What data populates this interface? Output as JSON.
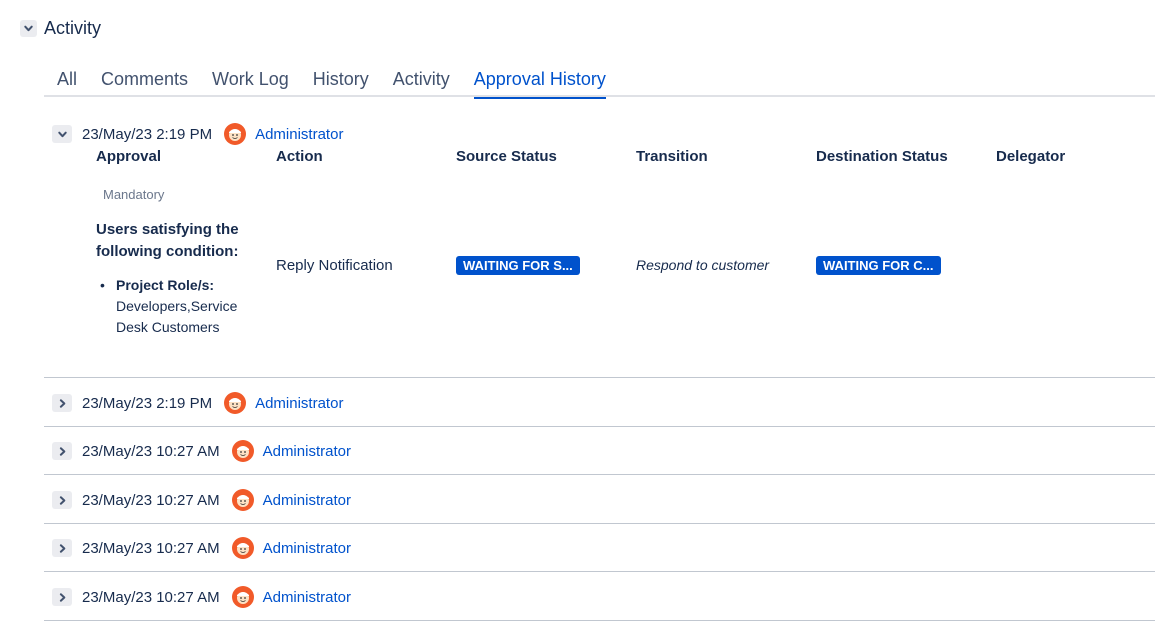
{
  "section": {
    "title": "Activity",
    "toggle_icon": "chevron-down-icon"
  },
  "tabs": [
    {
      "label": "All",
      "active": false
    },
    {
      "label": "Comments",
      "active": false
    },
    {
      "label": "Work Log",
      "active": false
    },
    {
      "label": "History",
      "active": false
    },
    {
      "label": "Activity",
      "active": false
    },
    {
      "label": "Approval History",
      "active": true
    }
  ],
  "expanded_entry": {
    "timestamp": "23/May/23 2:19 PM",
    "user": "Administrator",
    "columns": [
      "Approval",
      "Action",
      "Source Status",
      "Transition",
      "Destination Status",
      "Delegator"
    ],
    "approval": {
      "type": "Mandatory",
      "condition_title": "Users satisfying the following condition:",
      "role_label": "Project Role/s:",
      "role_value": "Developers,Service Desk Customers"
    },
    "action": "Reply Notification",
    "source_status": "WAITING FOR S...",
    "transition": "Respond to customer",
    "destination_status": "WAITING FOR C...",
    "delegator": ""
  },
  "collapsed_entries": [
    {
      "timestamp": "23/May/23 2:19 PM",
      "user": "Administrator"
    },
    {
      "timestamp": "23/May/23 10:27 AM",
      "user": "Administrator"
    },
    {
      "timestamp": "23/May/23 10:27 AM",
      "user": "Administrator"
    },
    {
      "timestamp": "23/May/23 10:27 AM",
      "user": "Administrator"
    },
    {
      "timestamp": "23/May/23 10:27 AM",
      "user": "Administrator"
    }
  ],
  "colors": {
    "link": "#0052cc",
    "lozenge": "#0052cc",
    "avatar": "#f15a29",
    "text": "#172b4d"
  }
}
